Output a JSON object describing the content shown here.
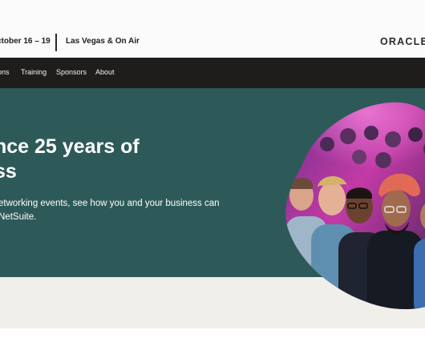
{
  "header": {
    "date": "ctober 16 – 19",
    "location": "Las Vegas & On Air",
    "logo": "ORACLE"
  },
  "nav": {
    "items": [
      "ons",
      "Training",
      "Sponsors",
      "About"
    ]
  },
  "hero": {
    "headline_line1": "nce 25 years of",
    "headline_line2": "ss",
    "subtext_line1": "etworking events, see how you and your business can",
    "subtext_line2": "NetSuite."
  },
  "colors": {
    "nav_background": "#1e1d1b",
    "hero_background": "#2d5a58",
    "band_background": "#f1efea",
    "stage_light": "#c33aa6"
  }
}
